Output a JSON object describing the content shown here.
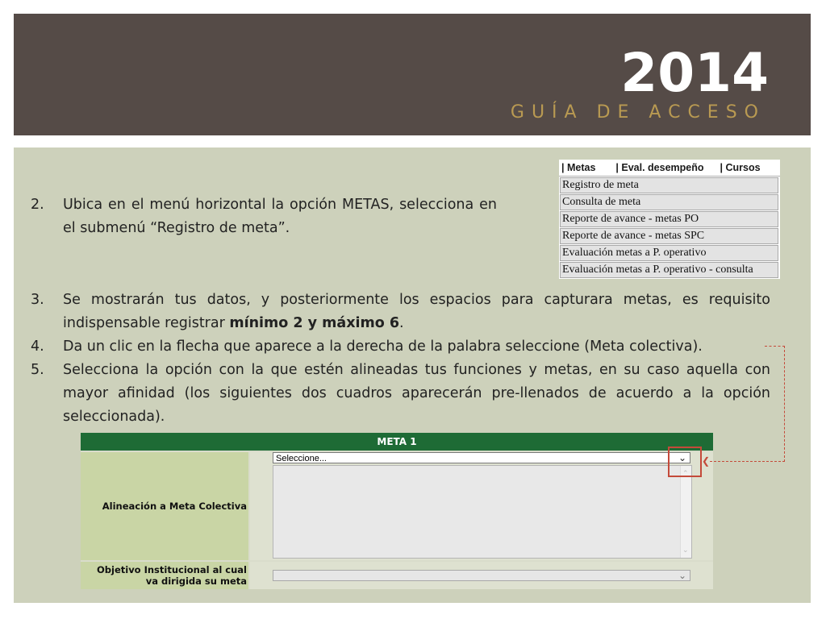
{
  "header": {
    "year": "2014",
    "subtitle": "GUÍA DE ACCESO"
  },
  "steps": [
    {
      "num": "2.",
      "text": "Ubica en el menú horizontal la opción METAS, selecciona en el submenú “Registro de meta”."
    },
    {
      "num": "3.",
      "text_before": "Se mostrarán tus datos, y posteriormente los espacios para capturara metas, es requisito indispensable registrar ",
      "text_bold": "mínimo 2 y máximo 6",
      "text_after": "."
    },
    {
      "num": "4.",
      "text": "Da un clic en la flecha que aparece a la derecha de la palabra seleccione (Meta colectiva)."
    },
    {
      "num": "5.",
      "text": "Selecciona la opción con la que estén alineadas tus funciones y metas, en su caso aquella con mayor afinidad (los siguientes dos cuadros aparecerán pre-llenados de acuerdo a la opción seleccionada)."
    }
  ],
  "menu": {
    "top": [
      "| Metas",
      "| Eval. desempeño",
      "| Cursos"
    ],
    "items": [
      "Registro de meta",
      "Consulta de meta",
      "Reporte de avance - metas PO",
      "Reporte de avance - metas SPC",
      "Evaluación metas a P. operativo",
      "Evaluación metas a P. operativo - consulta"
    ]
  },
  "form": {
    "title": "META 1",
    "row1_label": "Alineación a Meta Colectiva",
    "row1_select": "Seleccione...",
    "row2_label_line1": "Objetivo Institucional al cual",
    "row2_label_line2": "va dirigida su meta"
  },
  "colors": {
    "header_bg": "#554b47",
    "subtitle": "#b99a52",
    "content_bg": "#cdd1bb",
    "form_header": "#1e6b35",
    "annotation": "#c44a3a"
  }
}
